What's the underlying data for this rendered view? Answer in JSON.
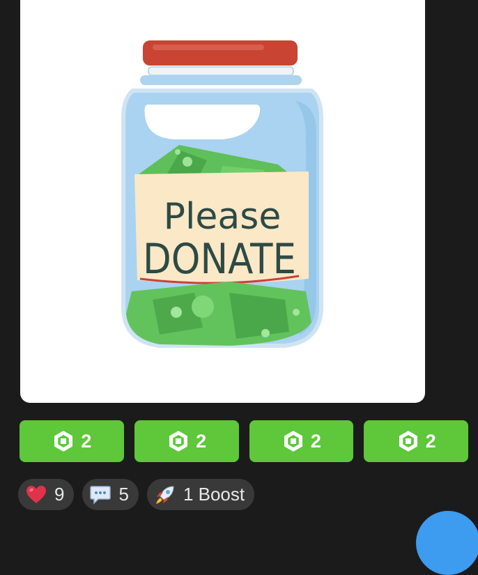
{
  "post": {
    "image_label_line1": "Please",
    "image_label_line2": "DONATE"
  },
  "donations": [
    {
      "amount": "2",
      "icon": "robux-icon"
    },
    {
      "amount": "2",
      "icon": "robux-icon"
    },
    {
      "amount": "2",
      "icon": "robux-icon"
    },
    {
      "amount": "2",
      "icon": "robux-icon"
    }
  ],
  "reactions": {
    "likes": {
      "count": "9",
      "icon": "heart-icon"
    },
    "comments": {
      "count": "5",
      "icon": "speech-bubble-icon"
    },
    "boosts": {
      "label": "1 Boost",
      "icon": "rocket-icon"
    }
  },
  "colors": {
    "background": "#1b1b1b",
    "donate_green": "#5ec73a",
    "pill_bg": "#393939",
    "fab_blue": "#3d9bf0"
  }
}
